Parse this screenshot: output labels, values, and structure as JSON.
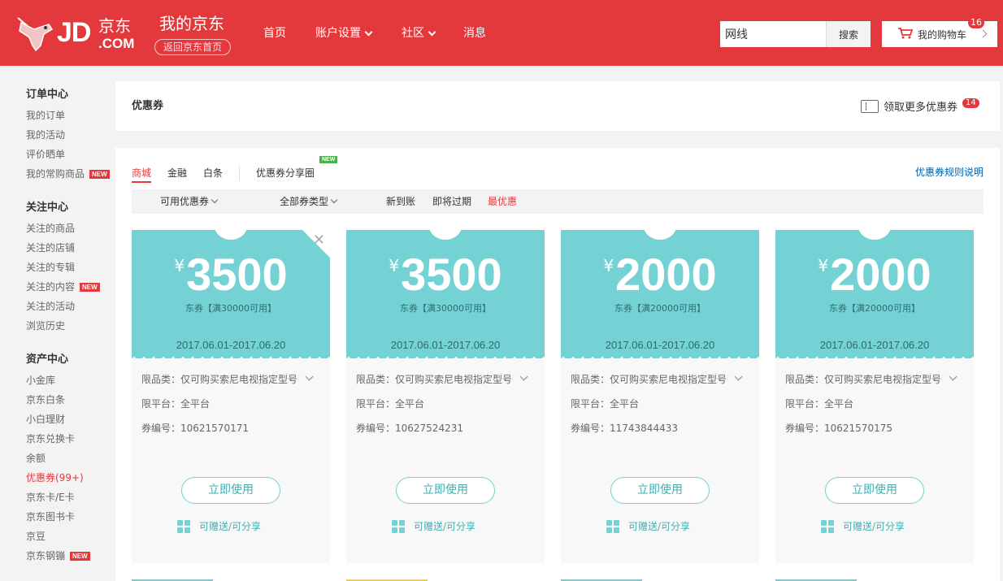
{
  "header": {
    "logo_text": "JD",
    "logo_cn": "京东",
    "logo_com": ".COM",
    "my_jd": "我的京东",
    "back_home": "返回京东首页",
    "nav": [
      {
        "label": "首页",
        "dropdown": false
      },
      {
        "label": "账户设置",
        "dropdown": true
      },
      {
        "label": "社区",
        "dropdown": true
      },
      {
        "label": "消息",
        "dropdown": false
      }
    ],
    "search_value": "网线",
    "search_button": "搜索",
    "cart_label": "我的购物车",
    "cart_count": "16",
    "brand_color": "#e4393c"
  },
  "sidebar": {
    "groups": [
      {
        "title": "订单中心",
        "items": [
          {
            "label": "我的订单"
          },
          {
            "label": "我的活动"
          },
          {
            "label": "评价晒单"
          },
          {
            "label": "我的常购商品",
            "badge": "NEW"
          }
        ]
      },
      {
        "title": "关注中心",
        "items": [
          {
            "label": "关注的商品"
          },
          {
            "label": "关注的店铺"
          },
          {
            "label": "关注的专辑"
          },
          {
            "label": "关注的内容",
            "badge": "NEW"
          },
          {
            "label": "关注的活动"
          },
          {
            "label": "浏览历史"
          }
        ]
      },
      {
        "title": "资产中心",
        "items": [
          {
            "label": "小金库"
          },
          {
            "label": "京东白条"
          },
          {
            "label": "小白理财"
          },
          {
            "label": "京东兑换卡"
          },
          {
            "label": "余额"
          },
          {
            "label": "优惠券(99+)",
            "active": true
          },
          {
            "label": "京东卡/E卡"
          },
          {
            "label": "京东图书卡"
          },
          {
            "label": "京豆"
          },
          {
            "label": "京东钢镚",
            "badge": "NEW"
          }
        ]
      }
    ]
  },
  "page": {
    "title": "优惠券",
    "get_more": "领取更多优惠券",
    "get_more_count": "14",
    "tabs": [
      {
        "label": "商城",
        "active": true
      },
      {
        "label": "金融"
      },
      {
        "label": "白条"
      },
      {
        "label": "优惠券分享圈",
        "tag": "NEW"
      }
    ],
    "rules_link": "优惠券规则说明",
    "filters": {
      "available": "可用优惠券",
      "type": "全部券类型",
      "sorts": [
        {
          "label": "新到账"
        },
        {
          "label": "即将过期"
        },
        {
          "label": "最优惠",
          "active": true
        }
      ]
    }
  },
  "coupons": [
    {
      "currency": "¥",
      "amount": "3500",
      "condition": "东券【满30000可用】",
      "date": "2017.06.01-2017.06.20",
      "scope": "限品类：仅可购买索尼电视指定型号",
      "platform": "限平台：全平台",
      "code": "券编号：10621570171",
      "use_label": "立即使用",
      "share_label": "可赠送/可分享",
      "dismissable": true
    },
    {
      "currency": "¥",
      "amount": "3500",
      "condition": "东券【满30000可用】",
      "date": "2017.06.01-2017.06.20",
      "scope": "限品类：仅可购买索尼电视指定型号",
      "platform": "限平台：全平台",
      "code": "券编号：10627524231",
      "use_label": "立即使用",
      "share_label": "可赠送/可分享"
    },
    {
      "currency": "¥",
      "amount": "2000",
      "condition": "东券【满20000可用】",
      "date": "2017.06.01-2017.06.20",
      "scope": "限品类：仅可购买索尼电视指定型号",
      "platform": "限平台：全平台",
      "code": "券编号：11743844433",
      "use_label": "立即使用",
      "share_label": "可赠送/可分享"
    },
    {
      "currency": "¥",
      "amount": "2000",
      "condition": "东券【满20000可用】",
      "date": "2017.06.01-2017.06.20",
      "scope": "限品类：仅可购买索尼电视指定型号",
      "platform": "限平台：全平台",
      "code": "券编号：10621570175",
      "use_label": "立即使用",
      "share_label": "可赠送/可分享"
    }
  ],
  "colors": {
    "coupon_teal": "#74d2d4",
    "accent_red": "#e4393c",
    "link_blue": "#005ea7"
  }
}
